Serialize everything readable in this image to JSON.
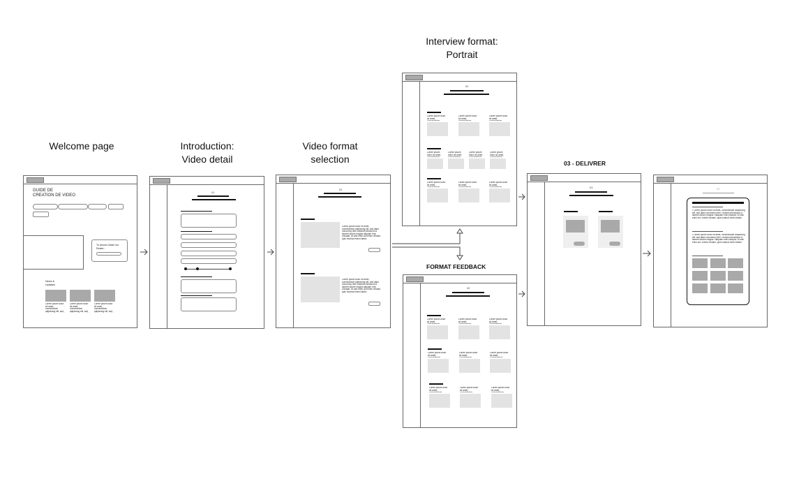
{
  "labels": {
    "welcome": "Welcome page",
    "intro_line1": "Introduction:",
    "intro_line2": "Video detail",
    "format_line1": "Video format",
    "format_line2": "selection",
    "interview_line1": "Interview format:",
    "interview_line2": "Portrait",
    "feedback": "FORMAT FEEDBACK",
    "deliver": "03 - DELIVRER"
  },
  "welcome_screen": {
    "title_line1": "GUIDE DE",
    "title_line2": "CREATION DE VIDEO",
    "help_line1": "Tu besoin d'aide sur",
    "help_line2": "Rester...",
    "news_line1": "News &",
    "news_line2": "Updates",
    "lorem": "Lorem ipsum dolor sit amet, consectetuer adipiscing elit, sed diam nonummy nibh euismod tincidunt ut laoreet dolore magna"
  },
  "screen_numbers": {
    "intro": "01",
    "format": "02",
    "interview": "02",
    "feedback": "02",
    "deliver": "03",
    "final": "03"
  },
  "lorem_short": "Lorem ipsum dolor sit amet, consectetuer adipiscing elit",
  "lorem_long": "Lorem ipsum dolor sit amet, consectetuer adipiscing elit, sed diam nonummy nibh euismod tincidunt ut laoreet dolore magna aliquam erat volutpat. Ut wisi enim ad minim veniam, quis nostrud exerci tation",
  "lorem_list": "• Lorem ipsum dolor sit amet, consectetuer adipiscing elit, sed diam nonummy nibh • euismod tincidunt ut laoreet dolore magna • aliquam erat volutpat. Ut wisi enim ad • minim veniam, quis nostrud exerci tation"
}
